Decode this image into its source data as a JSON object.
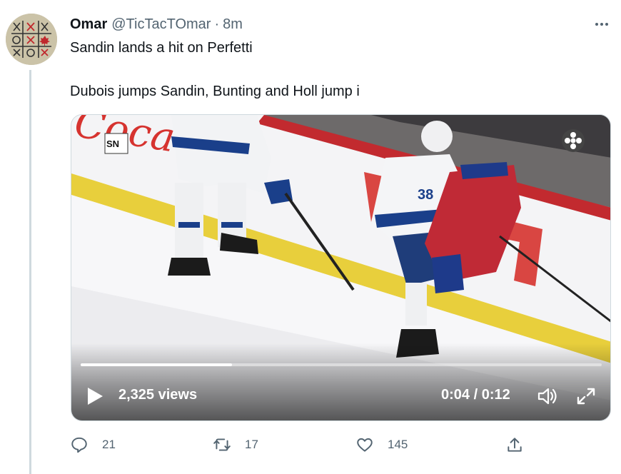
{
  "tweet": {
    "author_name": "Omar",
    "author_handle": "@TicTacTOmar",
    "separator": "·",
    "time": "8m",
    "text_line1": "Sandin lands a hit on Perfetti",
    "text_line2": "Dubois jumps Sandin, Bunting and Holl jump i"
  },
  "video": {
    "views": "2,325 views",
    "time_display": "0:04 / 0:12",
    "progress": 0.29,
    "overlay_logo": "SN",
    "jersey_number": "38"
  },
  "actions": {
    "replies": "21",
    "retweets": "17",
    "likes": "145"
  },
  "icons": {
    "more": "more-dots-icon",
    "reply": "reply-bubble-icon",
    "retweet": "retweet-icon",
    "like": "heart-icon",
    "share": "share-upload-icon",
    "play": "play-icon",
    "volume": "volume-icon",
    "fullscreen": "fullscreen-icon"
  },
  "colors": {
    "text_primary": "#0f1419",
    "text_secondary": "#536471",
    "thread_line": "#cfd9de"
  }
}
